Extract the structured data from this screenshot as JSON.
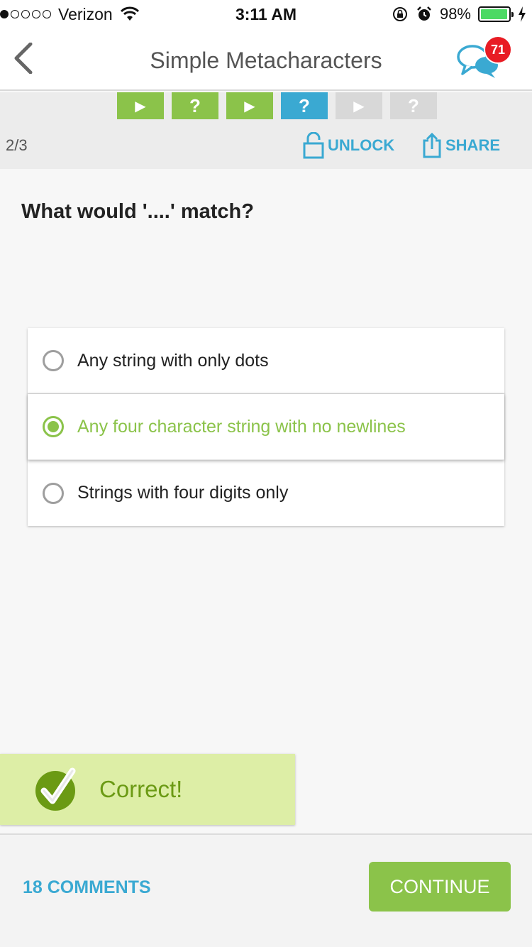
{
  "status_bar": {
    "carrier": "Verizon",
    "time": "3:11 AM",
    "battery_percent": "98%",
    "battery_level": 0.98,
    "signal_bars": 1,
    "icons": [
      "wifi-icon",
      "rotation-lock-icon",
      "alarm-icon",
      "battery-icon",
      "charging-icon"
    ]
  },
  "header": {
    "title": "Simple Metacharacters",
    "back_icon": "chevron-left-icon",
    "chat_icon": "chat-bubbles-icon",
    "notification_count": "71"
  },
  "progress": {
    "steps": [
      {
        "type": "lesson",
        "glyph": "▶",
        "state": "completed"
      },
      {
        "type": "quiz",
        "glyph": "?",
        "state": "completed"
      },
      {
        "type": "lesson",
        "glyph": "▶",
        "state": "completed"
      },
      {
        "type": "quiz",
        "glyph": "?",
        "state": "current"
      },
      {
        "type": "lesson",
        "glyph": "▶",
        "state": "locked"
      },
      {
        "type": "quiz",
        "glyph": "?",
        "state": "locked"
      }
    ],
    "page_count": "2/3",
    "unlock_label": "UNLOCK",
    "share_label": "SHARE"
  },
  "question": {
    "text": "What would '....' match?",
    "options": [
      {
        "label": "Any string with only dots",
        "selected": false
      },
      {
        "label": "Any four character string with no newlines",
        "selected": true
      },
      {
        "label": "Strings with four digits only",
        "selected": false
      }
    ]
  },
  "feedback": {
    "label": "Correct!",
    "icon": "checkmark-icon"
  },
  "footer": {
    "comments_label": "18 COMMENTS",
    "continue_label": "CONTINUE"
  },
  "colors": {
    "green": "#8bc34a",
    "blue": "#3aa9d2",
    "badge_red": "#e81c24",
    "feedback_bg": "#ddeea6"
  }
}
